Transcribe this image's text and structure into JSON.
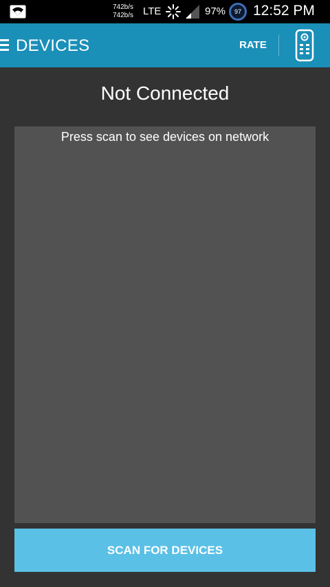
{
  "status_bar": {
    "net_speed_up": "742b/s",
    "net_speed_down": "742b/s",
    "network_type": "LTE",
    "battery_percent": "97%",
    "battery_badge": "97",
    "time": "12:52 PM",
    "icons": [
      "wifi-icon",
      "activity-spark-icon",
      "signal-icon",
      "battery-icon"
    ]
  },
  "app_bar": {
    "title": "DEVICES",
    "rate_label": "RATE",
    "icons": [
      "menu-icon",
      "remote-control-icon"
    ],
    "color": "#1a8fb8"
  },
  "main": {
    "connection_status": "Not Connected",
    "empty_hint": "Press scan to see devices on network",
    "scan_button_label": "SCAN FOR DEVICES",
    "scan_button_color": "#5bc0e6"
  }
}
